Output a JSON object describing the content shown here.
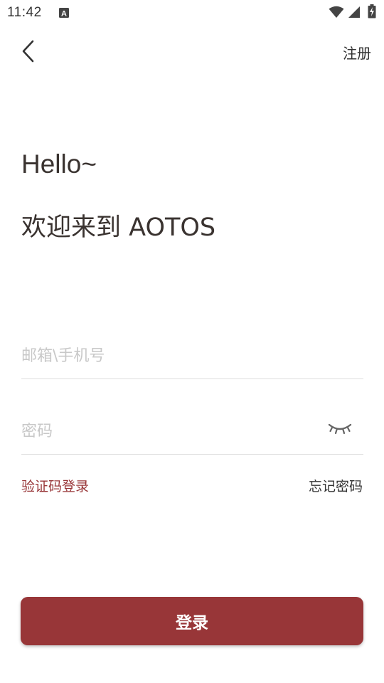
{
  "status_bar": {
    "time": "11:42",
    "notification_icon": "a-box-icon",
    "wifi_icon": "wifi-icon",
    "signal_icon": "cell-signal-icon",
    "battery_icon": "battery-charging-icon"
  },
  "app_bar": {
    "back_icon": "chevron-left-icon",
    "register_label": "注册"
  },
  "header": {
    "greeting": "Hello~",
    "welcome": "欢迎来到 AOTOS"
  },
  "form": {
    "account_placeholder": "邮箱\\手机号",
    "account_value": "",
    "password_placeholder": "密码",
    "password_value": "",
    "password_visibility_icon": "eye-closed-icon"
  },
  "links": {
    "sms_login": "验证码登录",
    "forgot_password": "忘记密码"
  },
  "actions": {
    "login_label": "登录"
  },
  "colors": {
    "accent": "#983638",
    "text": "#3a3330",
    "placeholder": "#c8c8c8",
    "divider": "#dddddd"
  }
}
